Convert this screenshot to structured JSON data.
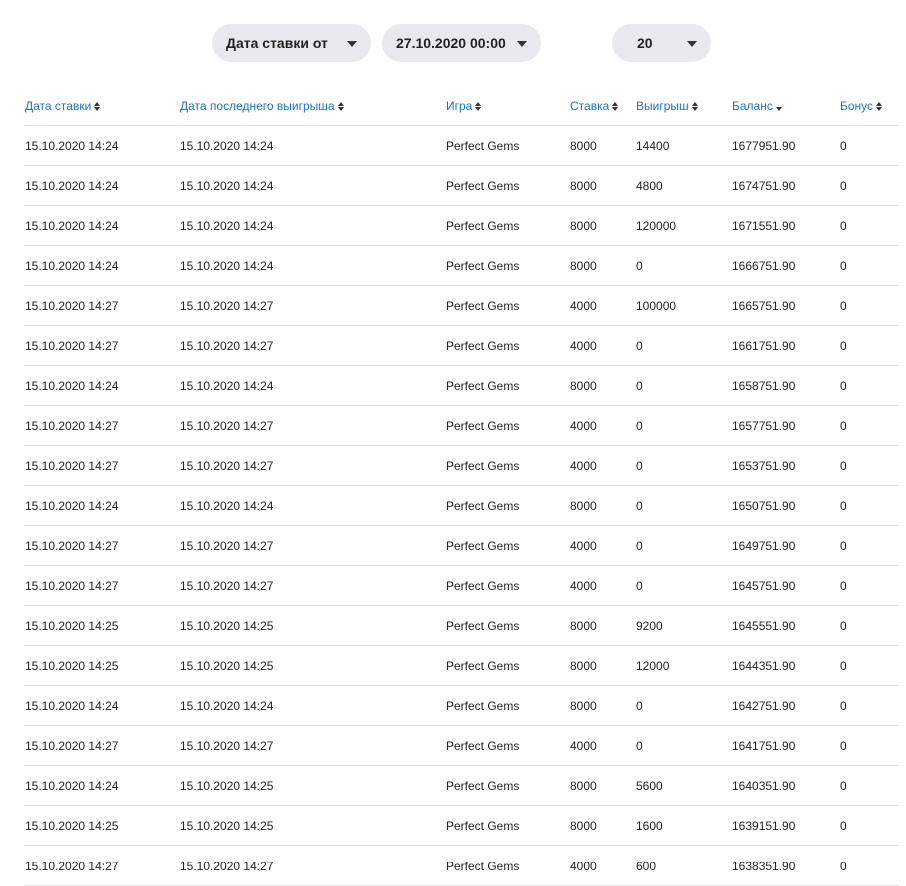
{
  "filters": {
    "date_type": "Дата ставки от",
    "date_value": "27.10.2020 00:00",
    "page_size": "20"
  },
  "table": {
    "columns": [
      {
        "label": "Дата ставки",
        "sort": "both"
      },
      {
        "label": "Дата последнего выигрыша",
        "sort": "both"
      },
      {
        "label": "Игра",
        "sort": "both"
      },
      {
        "label": "Ставка",
        "sort": "both"
      },
      {
        "label": "Выигрыш",
        "sort": "both"
      },
      {
        "label": "Баланс",
        "sort": "desc"
      },
      {
        "label": "Бонус",
        "sort": "both"
      }
    ],
    "rows": [
      [
        "15.10.2020 14:24",
        "15.10.2020 14:24",
        "Perfect Gems",
        "8000",
        "14400",
        "1677951.90",
        "0"
      ],
      [
        "15.10.2020 14:24",
        "15.10.2020 14:24",
        "Perfect Gems",
        "8000",
        "4800",
        "1674751.90",
        "0"
      ],
      [
        "15.10.2020 14:24",
        "15.10.2020 14:24",
        "Perfect Gems",
        "8000",
        "120000",
        "1671551.90",
        "0"
      ],
      [
        "15.10.2020 14:24",
        "15.10.2020 14:24",
        "Perfect Gems",
        "8000",
        "0",
        "1666751.90",
        "0"
      ],
      [
        "15.10.2020 14:27",
        "15.10.2020 14:27",
        "Perfect Gems",
        "4000",
        "100000",
        "1665751.90",
        "0"
      ],
      [
        "15.10.2020 14:27",
        "15.10.2020 14:27",
        "Perfect Gems",
        "4000",
        "0",
        "1661751.90",
        "0"
      ],
      [
        "15.10.2020 14:24",
        "15.10.2020 14:24",
        "Perfect Gems",
        "8000",
        "0",
        "1658751.90",
        "0"
      ],
      [
        "15.10.2020 14:27",
        "15.10.2020 14:27",
        "Perfect Gems",
        "4000",
        "0",
        "1657751.90",
        "0"
      ],
      [
        "15.10.2020 14:27",
        "15.10.2020 14:27",
        "Perfect Gems",
        "4000",
        "0",
        "1653751.90",
        "0"
      ],
      [
        "15.10.2020 14:24",
        "15.10.2020 14:24",
        "Perfect Gems",
        "8000",
        "0",
        "1650751.90",
        "0"
      ],
      [
        "15.10.2020 14:27",
        "15.10.2020 14:27",
        "Perfect Gems",
        "4000",
        "0",
        "1649751.90",
        "0"
      ],
      [
        "15.10.2020 14:27",
        "15.10.2020 14:27",
        "Perfect Gems",
        "4000",
        "0",
        "1645751.90",
        "0"
      ],
      [
        "15.10.2020 14:25",
        "15.10.2020 14:25",
        "Perfect Gems",
        "8000",
        "9200",
        "1645551.90",
        "0"
      ],
      [
        "15.10.2020 14:25",
        "15.10.2020 14:25",
        "Perfect Gems",
        "8000",
        "12000",
        "1644351.90",
        "0"
      ],
      [
        "15.10.2020 14:24",
        "15.10.2020 14:24",
        "Perfect Gems",
        "8000",
        "0",
        "1642751.90",
        "0"
      ],
      [
        "15.10.2020 14:27",
        "15.10.2020 14:27",
        "Perfect Gems",
        "4000",
        "0",
        "1641751.90",
        "0"
      ],
      [
        "15.10.2020 14:24",
        "15.10.2020 14:25",
        "Perfect Gems",
        "8000",
        "5600",
        "1640351.90",
        "0"
      ],
      [
        "15.10.2020 14:25",
        "15.10.2020 14:25",
        "Perfect Gems",
        "8000",
        "1600",
        "1639151.90",
        "0"
      ],
      [
        "15.10.2020 14:27",
        "15.10.2020 14:27",
        "Perfect Gems",
        "4000",
        "600",
        "1638351.90",
        "0"
      ]
    ]
  }
}
